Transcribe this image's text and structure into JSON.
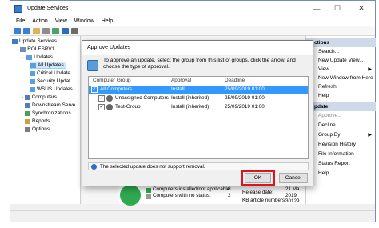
{
  "window": {
    "title": "Update Services",
    "controls": {
      "minimize": "—",
      "maximize": "☐",
      "close": "✕"
    }
  },
  "menu": [
    "File",
    "Action",
    "View",
    "Window",
    "Help"
  ],
  "tree": {
    "root": "Update Services",
    "server": "ROLESRV1",
    "updates": "Updates",
    "all_updates": "All Updates",
    "critical": "Critical Update",
    "security": "Security Updat",
    "wsus": "WSUS Updates",
    "computers": "Computers",
    "downstream": "Downstream Serve",
    "sync": "Synchronizations",
    "reports": "Reports",
    "options": "Options"
  },
  "actions": {
    "header1": "ctions",
    "items1": [
      "Search...",
      "New Update View...",
      "View",
      "New Window from Here",
      "Refresh",
      "Help"
    ],
    "header2": "pdate",
    "items2": [
      "Approve...",
      "Decline",
      "Group By",
      "Revision History",
      "File Information",
      "Status Report",
      "Help"
    ]
  },
  "dialog": {
    "title": "Approve Updates",
    "instructions": "To approve an update, select the group from this list of groups, click the arrow, and choose the type of approval.",
    "columns": [
      "Computer Group",
      "Approval",
      "Deadline"
    ],
    "rows": [
      {
        "group": "All Computers",
        "approval": "Install",
        "deadline": "25/09/2019 01:00"
      },
      {
        "group": "Unassigned Computers",
        "approval": "Install (inherited)",
        "deadline": "25/09/2019 01:00"
      },
      {
        "group": "Test-Group",
        "approval": "Install (inherited)",
        "deadline": "25/09/2019 01:00"
      }
    ],
    "status": "The selected update does not support removal.",
    "ok_label": "OK",
    "cancel_label": "Cancel"
  },
  "lower_panel": {
    "line1_label": "Computers installed/not applicable:",
    "line1_value": "6",
    "line2_label": "Computers with no status:",
    "line2_value": "2",
    "release_label": "Release date:",
    "release_value": "21 Ma",
    "release_value2": "2019",
    "kb_label": "KB article numbers:",
    "kb_value": "30129"
  },
  "colors": {
    "selection": "#3399ff",
    "highlight_box": "#e0131b",
    "action_header": "#cfd9e8",
    "pie": "#2fa84f"
  }
}
